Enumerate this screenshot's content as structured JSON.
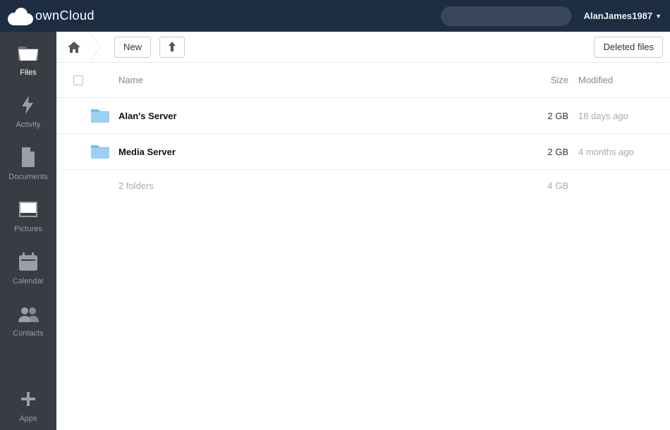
{
  "app": {
    "name": "ownCloud"
  },
  "header": {
    "search_placeholder": "",
    "username": "AlanJames1987",
    "caret": "▼"
  },
  "sidebar": {
    "items": [
      {
        "id": "files",
        "label": "Files",
        "active": true
      },
      {
        "id": "activity",
        "label": "Activity",
        "active": false
      },
      {
        "id": "documents",
        "label": "Documents",
        "active": false
      },
      {
        "id": "pictures",
        "label": "Pictures",
        "active": false
      },
      {
        "id": "calendar",
        "label": "Calendar",
        "active": false
      },
      {
        "id": "contacts",
        "label": "Contacts",
        "active": false
      }
    ],
    "apps": {
      "label": "Apps"
    }
  },
  "toolbar": {
    "new_label": "New",
    "deleted_label": "Deleted files"
  },
  "table": {
    "columns": {
      "name": "Name",
      "size": "Size",
      "modified": "Modified"
    },
    "rows": [
      {
        "name": "Alan's Server",
        "size": "2 GB",
        "modified": "18 days ago"
      },
      {
        "name": "Media Server",
        "size": "2 GB",
        "modified": "4 months ago"
      }
    ],
    "summary": {
      "count_text": "2 folders",
      "total_size": "4 GB"
    }
  },
  "colors": {
    "topbar": "#1d2d42",
    "sidebar": "#383c43",
    "muted": "#aaaaaa"
  }
}
